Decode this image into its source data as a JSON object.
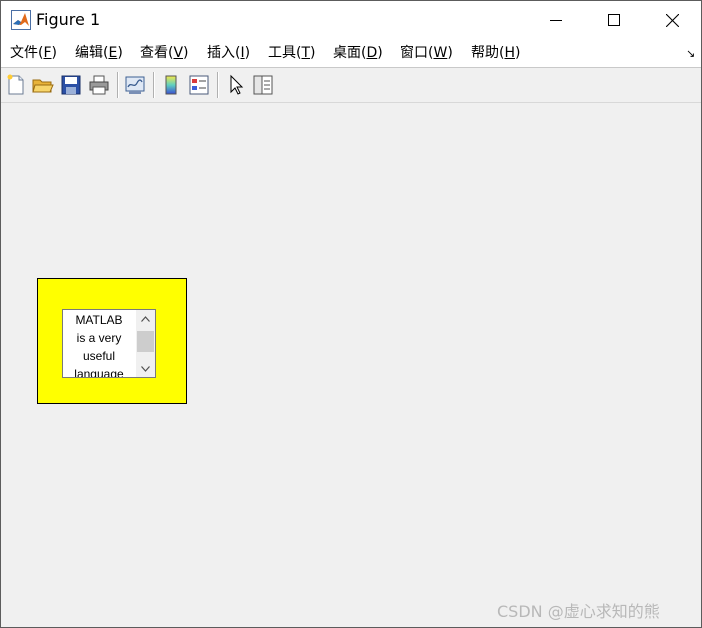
{
  "window": {
    "title": "Figure 1"
  },
  "menu": {
    "items": [
      {
        "label": "文件(",
        "key": "F",
        "close": ")"
      },
      {
        "label": "编辑(",
        "key": "E",
        "close": ")"
      },
      {
        "label": "查看(",
        "key": "V",
        "close": ")"
      },
      {
        "label": "插入(",
        "key": "I",
        "close": ")"
      },
      {
        "label": "工具(",
        "key": "T",
        "close": ")"
      },
      {
        "label": "桌面(",
        "key": "D",
        "close": ")"
      },
      {
        "label": "窗口(",
        "key": "W",
        "close": ")"
      },
      {
        "label": "帮助(",
        "key": "H",
        "close": ")"
      }
    ],
    "dock_glyph": "↘"
  },
  "toolbar": {
    "icons": [
      "new-file-icon",
      "open-folder-icon",
      "save-icon",
      "print-icon",
      "link-plot-icon",
      "colorbar-icon",
      "legend-icon",
      "pointer-icon",
      "property-editor-icon"
    ]
  },
  "listbox": {
    "lines": [
      "MATLAB",
      "is a very",
      "useful",
      "language"
    ]
  },
  "colors": {
    "panel_background": "#ffff00",
    "figure_background": "#f0f0f0"
  },
  "watermark": "CSDN @虚心求知的熊"
}
